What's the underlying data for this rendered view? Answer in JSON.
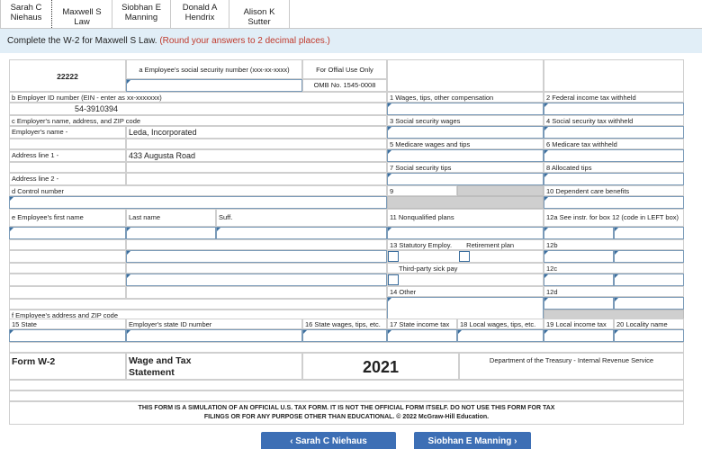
{
  "tabs": [
    {
      "label": "Sarah C\nNiehaus"
    },
    {
      "label": "Maxwell S Law"
    },
    {
      "label": "Siobhan E\nManning"
    },
    {
      "label": "Donald A\nHendrix"
    },
    {
      "label": "Alison K Sutter"
    }
  ],
  "instructions": {
    "text": "Complete the W-2 for Maxwell S Law.",
    "hint": "(Round your answers to 2 decimal places.)"
  },
  "form": {
    "control_code": "22222",
    "ssn_label": "a  Employee's social security number (xxx-xx-xxxx)",
    "official_use": "For Offial Use Only",
    "omb": "OMB No. 1545-0008",
    "ein_label": "b  Employer ID number (EIN - enter as xx-xxxxxxx)",
    "ein_value": "54-3910394",
    "employer_label": "c  Employer's name, address, and ZIP code",
    "employer_name_label": "Employer's name -",
    "employer_name": "Leda, Incorporated",
    "address1_label": "Address line 1 -",
    "address1": "433 Augusta Road",
    "address2_label": "Address line 2 -",
    "control_label": "d  Control number",
    "first_name_label": "e  Employee's first name",
    "last_name_label": "Last name",
    "suff_label": "Suff.",
    "employee_address_label": "f  Employee's address and ZIP code",
    "box1": "1  Wages, tips, other compensation",
    "box2": "2  Federal income tax withheld",
    "box3": "3  Social security wages",
    "box4": "4  Social security tax withheld",
    "box5": "5  Medicare wages and tips",
    "box6": "6  Medicare tax withheld",
    "box7": "7  Social security tips",
    "box8": "8  Allocated tips",
    "box9": "9",
    "box10": "10 Dependent care benefits",
    "box11": "11 Nonqualified plans",
    "box12a": "12a See instr. for box 12 (code in LEFT box)",
    "box13": "13 Statutory Employ.",
    "retirement": "Retirement plan",
    "sick_pay": "Third-party sick pay",
    "box12b": "12b",
    "box12c": "12c",
    "box12d": "12d",
    "box14": "14 Other",
    "box15": "15 State",
    "employer_state_id": "Employer's state ID number",
    "box16": "16 State wages, tips, etc.",
    "box17": "17 State income tax",
    "box18": "18 Local wages, tips, etc.",
    "box19": "19 Local income tax",
    "box20": "20 Locality name",
    "form_name": "Form W-2",
    "form_title1": "Wage and Tax",
    "form_title2": "Statement",
    "year": "2021",
    "dept": "Department of the Treasury - Internal Revenue Service",
    "disclaimer1": "THIS FORM IS A SIMULATION OF AN OFFICIAL U.S. TAX FORM. IT IS NOT THE OFFICIAL FORM ITSELF. DO NOT USE THIS FORM FOR TAX",
    "disclaimer2": "FILINGS OR FOR ANY PURPOSE OTHER THAN EDUCATIONAL. © 2022 McGraw-Hill Education."
  },
  "nav": {
    "prev": "‹   Sarah C Niehaus",
    "next": "Siobhan E Manning   ›"
  }
}
